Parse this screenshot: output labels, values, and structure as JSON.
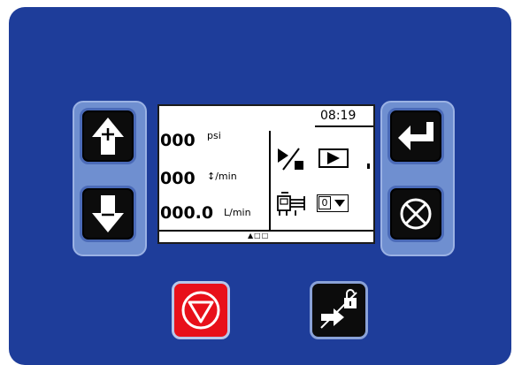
{
  "display": {
    "clock": "08:19",
    "pressure_value": "000",
    "pressure_unit": "psi",
    "cycle_value": "000",
    "cycle_unit": "↕/min",
    "flow_value": "000.0",
    "flow_unit": "L/min",
    "mode_field_value": "0",
    "screen_indicator": "▲□□"
  },
  "icons": {
    "up": "arrow-up-plus-icon",
    "down": "arrow-down-minus-icon",
    "enter": "enter-icon",
    "cancel": "cancel-icon",
    "stop": "stop-icon",
    "lock": "lock-screen-icon",
    "run_stop": "run-stop-mode-icon",
    "play": "play-icon",
    "pump": "pump-icon"
  },
  "colors": {
    "panel": "#1e3d9a",
    "stop_button": "#e8101a"
  }
}
